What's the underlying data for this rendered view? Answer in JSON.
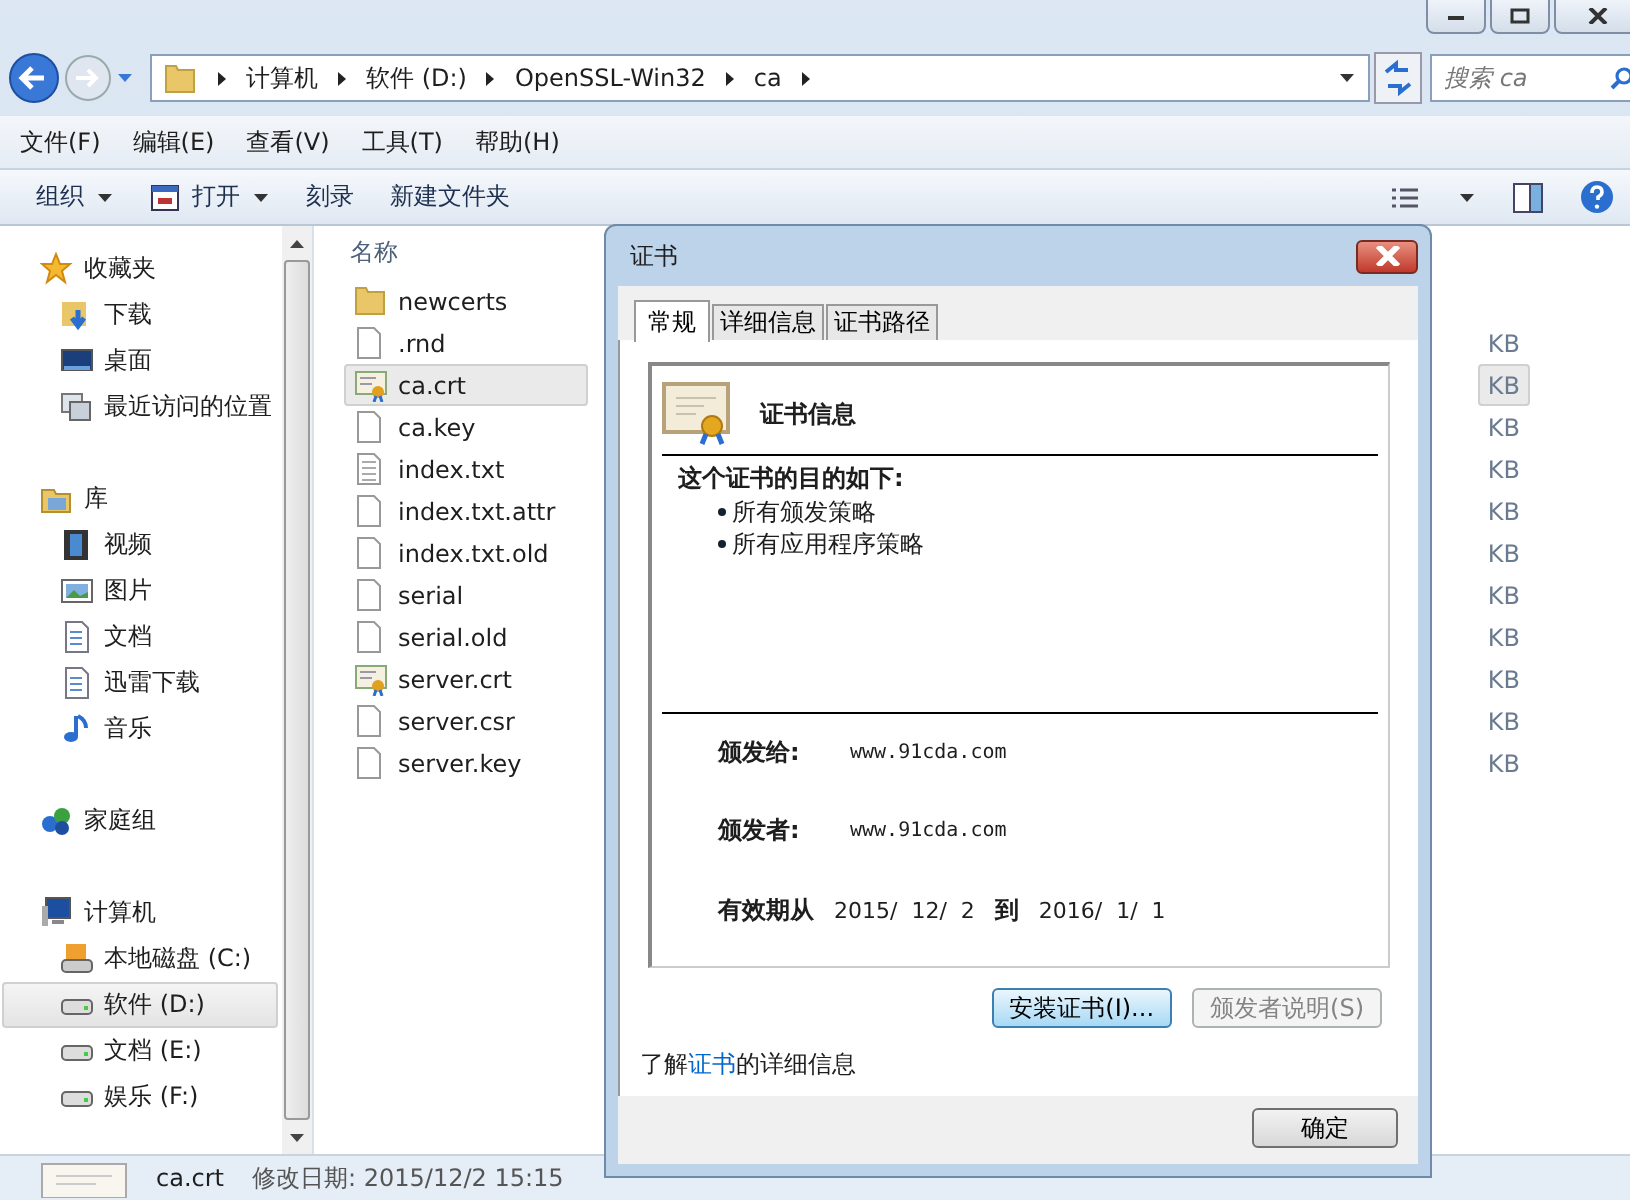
{
  "address_bar": {
    "crumbs": [
      "计算机",
      "软件 (D:)",
      "OpenSSL-Win32",
      "ca"
    ]
  },
  "search": {
    "placeholder": "搜索 ca"
  },
  "menu": [
    "文件(F)",
    "编辑(E)",
    "查看(V)",
    "工具(T)",
    "帮助(H)"
  ],
  "toolbar": [
    {
      "label": "组织",
      "kind": "dropdown"
    },
    {
      "label": "打开",
      "kind": "open"
    },
    {
      "label": "刻录",
      "kind": "plain"
    },
    {
      "label": "新建文件夹",
      "kind": "plain"
    }
  ],
  "nav": [
    {
      "label": "收藏夹",
      "kind": "star",
      "children": [
        {
          "label": "下载",
          "kind": "folder-down",
          "selected": false
        },
        {
          "label": "桌面",
          "kind": "desktop",
          "selected": false
        },
        {
          "label": "最近访问的位置",
          "kind": "recent",
          "selected": false
        }
      ]
    },
    {
      "label": "库",
      "kind": "library",
      "children": [
        {
          "label": "视频",
          "kind": "film",
          "selected": false
        },
        {
          "label": "图片",
          "kind": "image",
          "selected": false
        },
        {
          "label": "文档",
          "kind": "doc",
          "selected": false
        },
        {
          "label": "迅雷下载",
          "kind": "doc",
          "selected": false
        },
        {
          "label": "音乐",
          "kind": "music",
          "selected": false
        }
      ]
    },
    {
      "label": "家庭组",
      "kind": "homegroup"
    },
    {
      "label": "计算机",
      "kind": "computer",
      "children": [
        {
          "label": "本地磁盘 (C:)",
          "kind": "drive-system",
          "selected": false
        },
        {
          "label": "软件 (D:)",
          "kind": "drive",
          "selected": true
        },
        {
          "label": "文档 (E:)",
          "kind": "drive",
          "selected": false
        },
        {
          "label": "娱乐 (F:)",
          "kind": "drive",
          "selected": false
        }
      ]
    }
  ],
  "file_list": {
    "column": "名称",
    "files": [
      {
        "name": "newcerts",
        "kind": "folder",
        "selected": false
      },
      {
        "name": ".rnd",
        "kind": "file",
        "size": "KB",
        "selected": false
      },
      {
        "name": "ca.crt",
        "kind": "certificate",
        "size": "KB",
        "selected": true
      },
      {
        "name": "ca.key",
        "kind": "file",
        "size": "KB",
        "selected": false
      },
      {
        "name": "index.txt",
        "kind": "text",
        "size": "KB",
        "selected": false
      },
      {
        "name": "index.txt.attr",
        "kind": "file",
        "size": "KB",
        "selected": false
      },
      {
        "name": "index.txt.old",
        "kind": "file",
        "size": "KB",
        "selected": false
      },
      {
        "name": "serial",
        "kind": "file",
        "size": "KB",
        "selected": false
      },
      {
        "name": "serial.old",
        "kind": "file",
        "size": "KB",
        "selected": false
      },
      {
        "name": "server.crt",
        "kind": "certificate",
        "size": "KB",
        "selected": false
      },
      {
        "name": "server.csr",
        "kind": "file",
        "size": "KB",
        "selected": false
      },
      {
        "name": "server.key",
        "kind": "file",
        "size": "KB",
        "selected": false
      }
    ]
  },
  "status_bar": {
    "name": "ca.crt",
    "modified": "修改日期: 2015/12/2 15:15"
  },
  "dialog": {
    "title": "证书",
    "tabs": [
      {
        "label": "常规",
        "selected": true
      },
      {
        "label": "详细信息",
        "selected": false
      },
      {
        "label": "证书路径",
        "selected": false
      }
    ],
    "header": "证书信息",
    "purpose_heading": "这个证书的目的如下:",
    "purposes": [
      "所有颁发策略",
      "所有应用程序策略"
    ],
    "fields": [
      {
        "label": "颁发给:",
        "value": "www.91cda.com"
      },
      {
        "label": "颁发者:",
        "value": "www.91cda.com"
      }
    ],
    "validity": {
      "label": "有效期从",
      "from": "2015/  12/  2",
      "to_label": "到",
      "to": "2016/  1/  1"
    },
    "buttons": [
      {
        "label": "安装证书(I)...",
        "disabled": false
      },
      {
        "label": "颁发者说明(S)",
        "disabled": true
      }
    ],
    "info": {
      "before": "了解",
      "link": "证书",
      "after": "的详细信息"
    },
    "ok": "确定"
  }
}
